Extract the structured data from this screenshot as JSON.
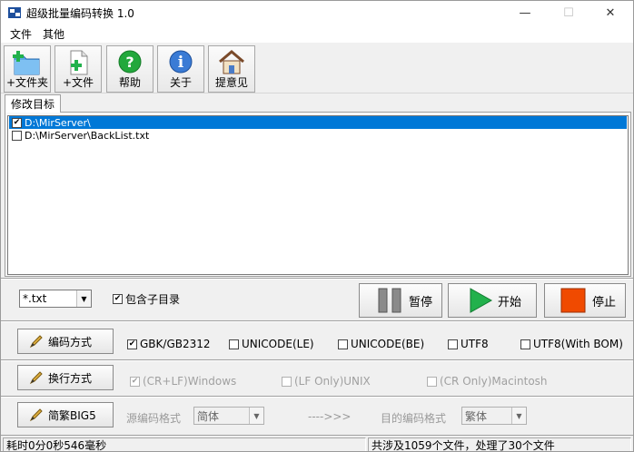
{
  "window": {
    "title": "超级批量编码转换 1.0",
    "controls": {
      "minimize": "—",
      "maximize": "☐",
      "close": "✕"
    }
  },
  "menu": {
    "items": [
      "文件",
      "其他"
    ]
  },
  "toolbar": {
    "buttons": [
      {
        "label": "+文件夹",
        "icon": "folder-add-icon"
      },
      {
        "label": "+文件",
        "icon": "file-add-icon"
      },
      {
        "label": "帮助",
        "icon": "help-icon"
      },
      {
        "label": "关于",
        "icon": "info-icon"
      },
      {
        "label": "提意见",
        "icon": "home-icon"
      }
    ]
  },
  "tabs": [
    {
      "label": "修改目标",
      "active": true
    }
  ],
  "targets": [
    {
      "path": "D:\\MirServer\\",
      "checked": true,
      "selected": true
    },
    {
      "path": "D:\\MirServer\\BackList.txt",
      "checked": false,
      "selected": false
    }
  ],
  "filter": {
    "pattern": "*.txt",
    "include_subdirs_label": "包含子目录",
    "include_subdirs": true
  },
  "actions": {
    "pause": "暂停",
    "start": "开始",
    "stop": "停止"
  },
  "encoding": {
    "button": "编码方式",
    "options": [
      {
        "label": "GBK/GB2312",
        "checked": true
      },
      {
        "label": "UNICODE(LE)",
        "checked": false
      },
      {
        "label": "UNICODE(BE)",
        "checked": false
      },
      {
        "label": "UTF8",
        "checked": false
      },
      {
        "label": "UTF8(With BOM)",
        "checked": false
      }
    ]
  },
  "line_endings": {
    "button": "换行方式",
    "options": [
      {
        "label": "(CR+LF)Windows",
        "checked": true
      },
      {
        "label": "(LF Only)UNIX",
        "checked": false
      },
      {
        "label": "(CR Only)Macintosh",
        "checked": false
      }
    ]
  },
  "big5": {
    "button": "简繁BIG5",
    "source_label": "源编码格式",
    "source_value": "简体",
    "arrow_text": "---->>>",
    "target_label": "目的编码格式",
    "target_value": "繁体"
  },
  "status": {
    "elapsed": "耗时0分0秒546毫秒",
    "summary": "共涉及1059个文件，处理了30个文件"
  },
  "colors": {
    "selection": "#0078d7",
    "start_green": "#22b14c",
    "stop_orange": "#f04a00"
  }
}
